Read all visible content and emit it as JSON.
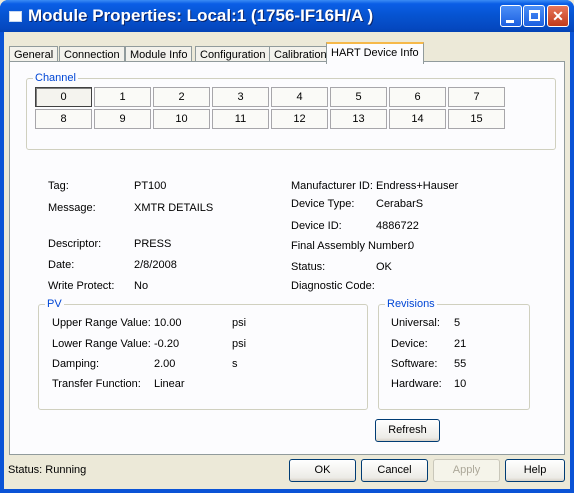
{
  "window": {
    "title": "Module Properties: Local:1 (1756-IF16H/A )",
    "minimize_icon": "minimize-icon",
    "maximize_icon": "maximize-icon",
    "close_icon": "close-icon",
    "close_glyph": "✕"
  },
  "tabs": [
    {
      "label": "General"
    },
    {
      "label": "Connection"
    },
    {
      "label": "Module Info"
    },
    {
      "label": "Configuration"
    },
    {
      "label": "Calibration"
    },
    {
      "label": "HART Device Info",
      "active": true
    }
  ],
  "channel": {
    "title": "Channel",
    "buttons": [
      "0",
      "1",
      "2",
      "3",
      "4",
      "5",
      "6",
      "7",
      "8",
      "9",
      "10",
      "11",
      "12",
      "13",
      "14",
      "15"
    ],
    "selected": "0"
  },
  "device": {
    "tag_label": "Tag:",
    "tag_value": "PT100",
    "message_label": "Message:",
    "message_value": "XMTR DETAILS",
    "descriptor_label": "Descriptor:",
    "descriptor_value": "PRESS",
    "date_label": "Date:",
    "date_value": "2/8/2008",
    "write_protect_label": "Write Protect:",
    "write_protect_value": "No",
    "manufacturer_label": "Manufacturer ID:",
    "manufacturer_value": "Endress+Hauser",
    "device_type_label": "Device Type:",
    "device_type_value": "CerabarS",
    "device_id_label": "Device ID:",
    "device_id_value": "4886722",
    "final_assembly_label": "Final Assembly Number:",
    "final_assembly_value": "0",
    "status_label": "Status:",
    "status_value": "OK",
    "diagnostic_label": "Diagnostic Code:",
    "diagnostic_value": ""
  },
  "pv": {
    "title": "PV",
    "urv_label": "Upper Range Value:",
    "urv_value": "10.00",
    "urv_unit": "psi",
    "lrv_label": "Lower Range Value:",
    "lrv_value": "-0.20",
    "lrv_unit": "psi",
    "damping_label": "Damping:",
    "damping_value": "2.00",
    "damping_unit": "s",
    "transfer_label": "Transfer Function:",
    "transfer_value": "Linear"
  },
  "revisions": {
    "title": "Revisions",
    "universal_label": "Universal:",
    "universal_value": "5",
    "device_label": "Device:",
    "device_value": "21",
    "software_label": "Software:",
    "software_value": "55",
    "hardware_label": "Hardware:",
    "hardware_value": "10"
  },
  "refresh_label": "Refresh",
  "status": "Status:  Running",
  "footer": {
    "ok_label": "OK",
    "cancel_label": "Cancel",
    "apply_label": "Apply",
    "help_label": "Help"
  }
}
